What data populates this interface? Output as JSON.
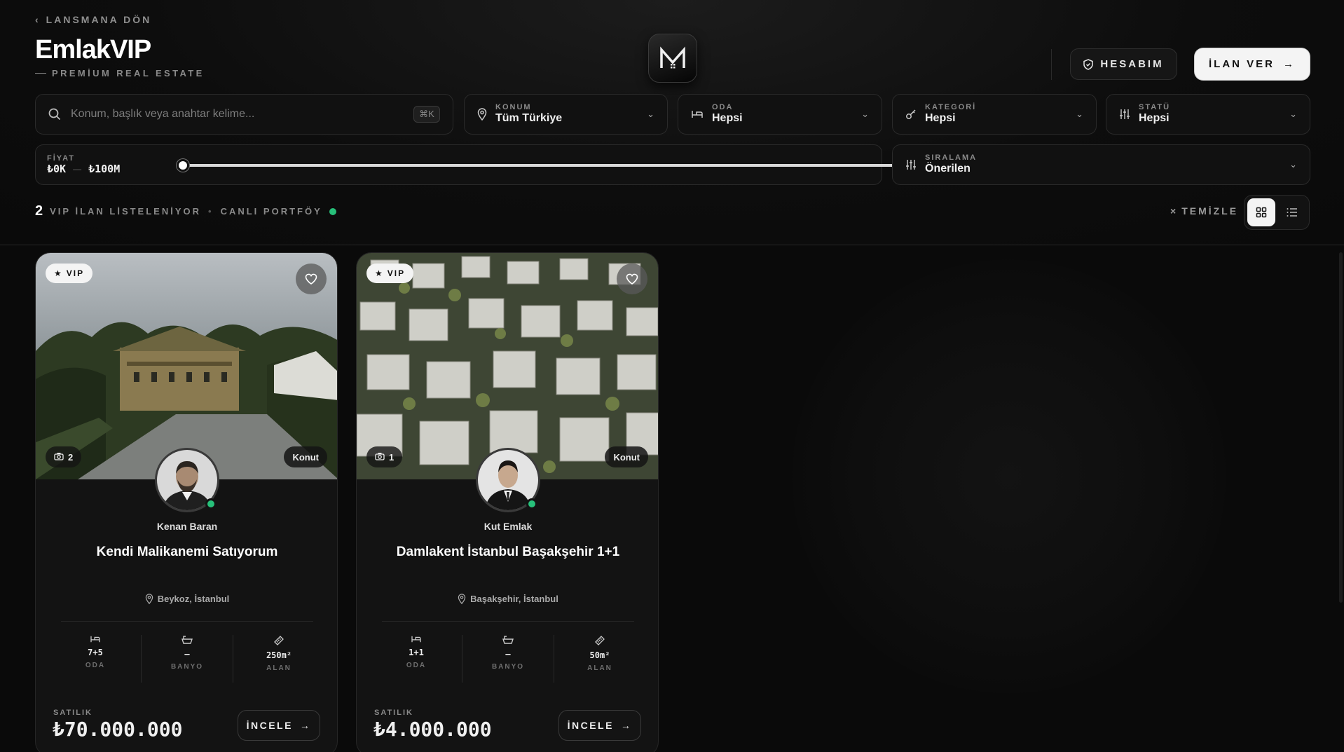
{
  "nav": {
    "back_label": "LANSMANA DÖN"
  },
  "brand": {
    "title": "EmlakVIP",
    "subtitle": "PREMİUM REAL ESTATE"
  },
  "header": {
    "account_label": "HESABIM",
    "post_label": "İLAN VER"
  },
  "search": {
    "placeholder": "Konum, başlık veya anahtar kelime...",
    "shortcut": "⌘K"
  },
  "filters": {
    "location": {
      "label": "KONUM",
      "value": "Tüm Türkiye"
    },
    "rooms": {
      "label": "ODA",
      "value": "Hepsi"
    },
    "category": {
      "label": "KATEGORİ",
      "value": "Hepsi"
    },
    "status": {
      "label": "STATÜ",
      "value": "Hepsi"
    },
    "sort": {
      "label": "SIRALAMA",
      "value": "Önerilen"
    },
    "price": {
      "label": "FİYAT",
      "min_text": "₺0K",
      "max_text": "₺100M",
      "sep": "—",
      "range_min_fraction": 0,
      "range_max_fraction": 1
    }
  },
  "results": {
    "count": "2",
    "label": "VIP İLAN LİSTELENİYOR",
    "dot": "•",
    "live_label": "CANLI PORTFÖY"
  },
  "toolbar": {
    "clear_label": "TEMİZLE"
  },
  "listings": [
    {
      "badge": "VIP",
      "photos": "2",
      "category": "Konut",
      "agent": "Kenan Baran",
      "title": "Kendi Malikanemi Satıyorum",
      "location": "Beykoz, İstanbul",
      "rooms": "7+5",
      "baths": "–",
      "area": "250m²",
      "room_label": "ODA",
      "bath_label": "BANYO",
      "area_label": "ALAN",
      "sale_label": "SATILIK",
      "price": "₺70.000.000",
      "action_label": "İNCELE"
    },
    {
      "badge": "VIP",
      "photos": "1",
      "category": "Konut",
      "agent": "Kut Emlak",
      "title": "Damlakent İstanbul Başakşehir 1+1",
      "location": "Başakşehir, İstanbul",
      "rooms": "1+1",
      "baths": "–",
      "area": "50m²",
      "room_label": "ODA",
      "bath_label": "BANYO",
      "area_label": "ALAN",
      "sale_label": "SATILIK",
      "price": "₺4.000.000",
      "action_label": "İNCELE"
    }
  ],
  "colors": {
    "accent_live": "#27c07a",
    "background": "#0a0a0a"
  }
}
